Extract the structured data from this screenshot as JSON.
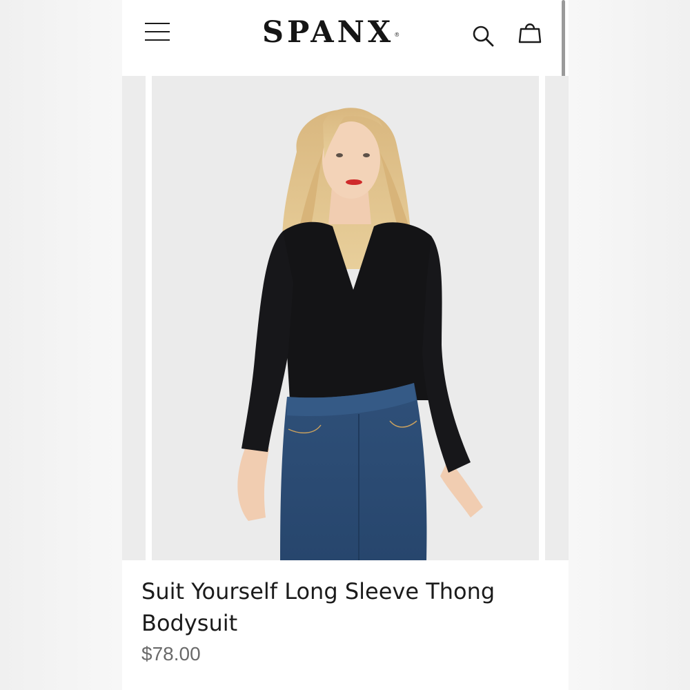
{
  "header": {
    "menu_icon": "hamburger-menu-icon",
    "logo_text": "SPANX",
    "logo_mark": "®",
    "search_icon": "search-icon",
    "bag_icon": "shopping-bag-icon"
  },
  "product": {
    "title": "Suit Yourself Long Sleeve Thong Bodysuit",
    "price": "$78.00"
  },
  "colors": {
    "text": "#1b1b1b",
    "price": "#6a6a6a",
    "image_bg": "#ebebeb",
    "garment_top": "#141416",
    "denim": "#2b4a72"
  }
}
